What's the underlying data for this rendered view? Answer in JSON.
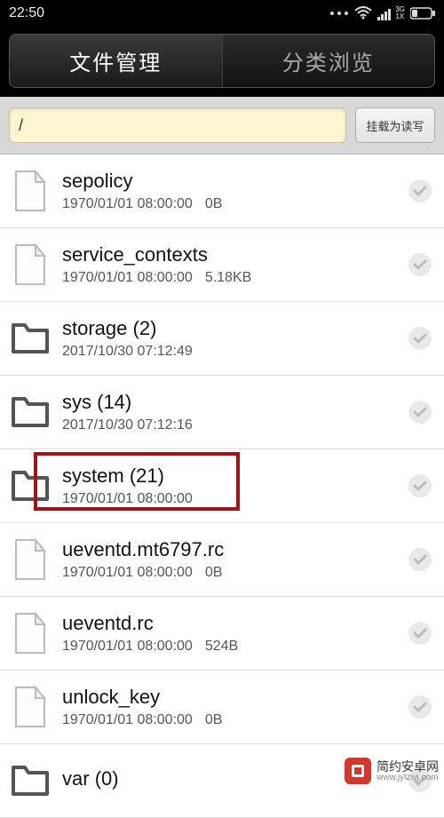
{
  "status": {
    "time": "22:50",
    "net_top": "3G",
    "net_bot": "1X"
  },
  "tabs": {
    "file_manager": "文件管理",
    "category_browse": "分类浏览"
  },
  "path": {
    "value": "/",
    "mount_label": "挂载为读写"
  },
  "items": [
    {
      "type": "file",
      "name": "sepolicy",
      "count": "",
      "date": "1970/01/01 08:00:00",
      "size": "0B"
    },
    {
      "type": "file",
      "name": "service_contexts",
      "count": "",
      "date": "1970/01/01 08:00:00",
      "size": "5.18KB"
    },
    {
      "type": "folder",
      "name": "storage",
      "count": "(2)",
      "date": "2017/10/30 07:12:49",
      "size": ""
    },
    {
      "type": "folder",
      "name": "sys",
      "count": "(14)",
      "date": "2017/10/30 07:12:16",
      "size": ""
    },
    {
      "type": "folder",
      "name": "system",
      "count": "(21)",
      "date": "1970/01/01 08:00:00",
      "size": "",
      "highlight": true
    },
    {
      "type": "file",
      "name": "ueventd.mt6797.rc",
      "count": "",
      "date": "1970/01/01 08:00:00",
      "size": "0B"
    },
    {
      "type": "file",
      "name": "ueventd.rc",
      "count": "",
      "date": "1970/01/01 08:00:00",
      "size": "524B"
    },
    {
      "type": "file",
      "name": "unlock_key",
      "count": "",
      "date": "1970/01/01 08:00:00",
      "size": "0B"
    },
    {
      "type": "folder",
      "name": "var",
      "count": "(0)",
      "date": "",
      "size": ""
    }
  ],
  "watermark": {
    "title": "简约安卓网",
    "url": "www.jylzwj.com"
  }
}
